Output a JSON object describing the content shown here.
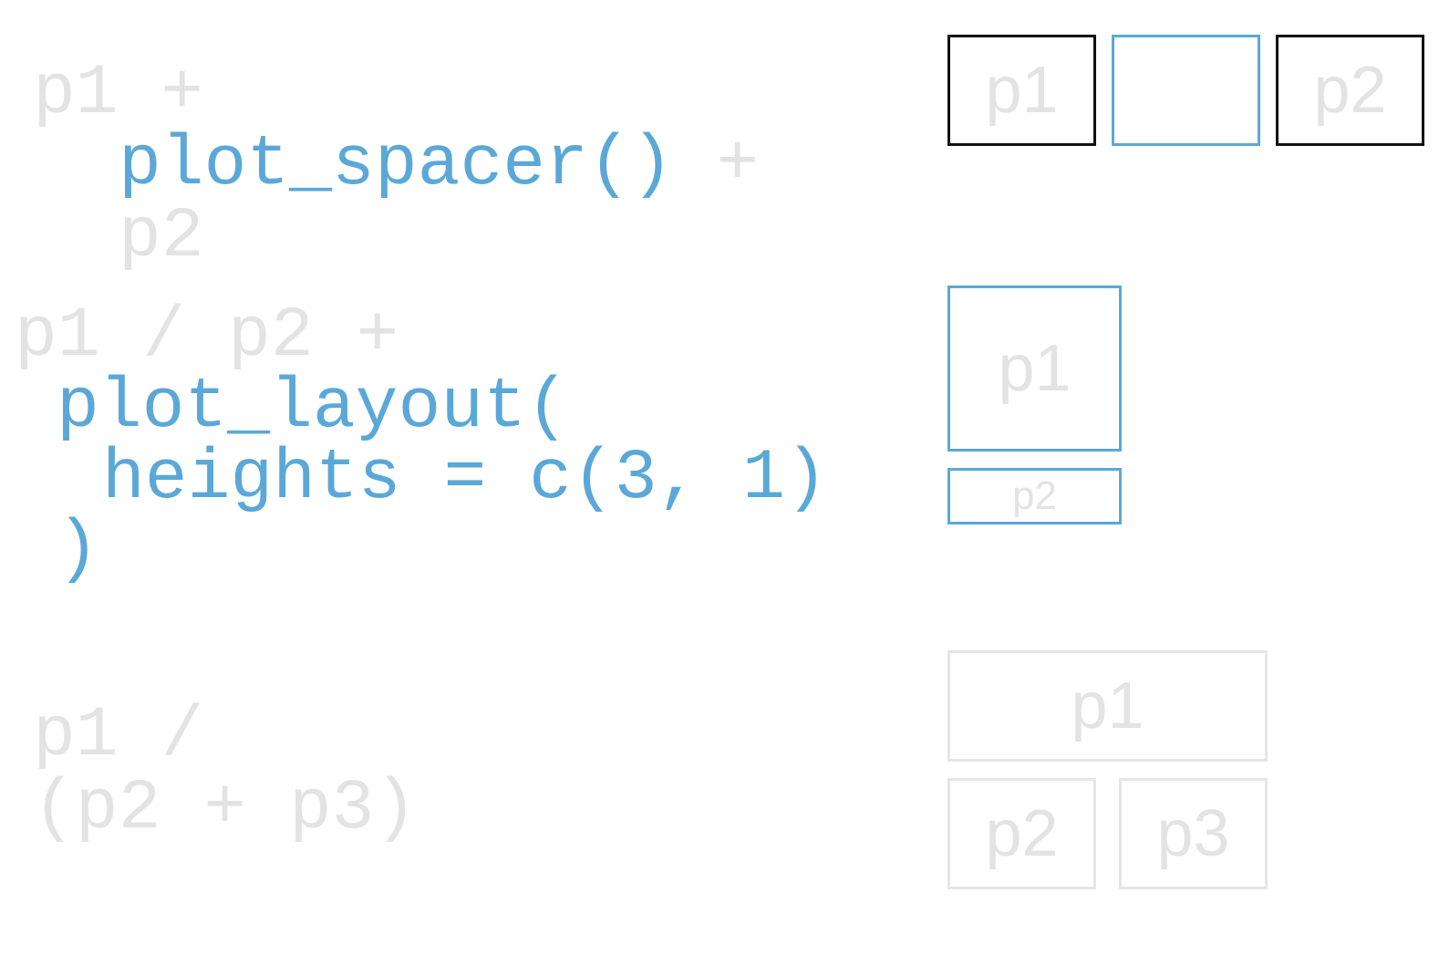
{
  "colors": {
    "faint_text": "#e3e3e3",
    "highlight": "#5ba8d8",
    "black_border": "#111111",
    "gray_border": "#e6e6e6"
  },
  "examples": [
    {
      "id": "spacer",
      "code": {
        "line1": "p1 +",
        "line2_fn": "plot_spacer()",
        "line2_op": " +",
        "line3": "p2"
      },
      "diagram": {
        "p1": "p1",
        "spacer": "",
        "p2": "p2"
      }
    },
    {
      "id": "layout",
      "code": {
        "line1": "p1 / p2 +",
        "line2": "plot_layout(",
        "line3": "heights = c(3, 1)",
        "line4": ")"
      },
      "diagram": {
        "p1": "p1",
        "p2": "p2",
        "heights": [
          3,
          1
        ]
      }
    },
    {
      "id": "nested",
      "code": {
        "line1": "p1 /",
        "line2": "(p2 + p3)"
      },
      "diagram": {
        "p1": "p1",
        "p2": "p2",
        "p3": "p3"
      }
    }
  ]
}
